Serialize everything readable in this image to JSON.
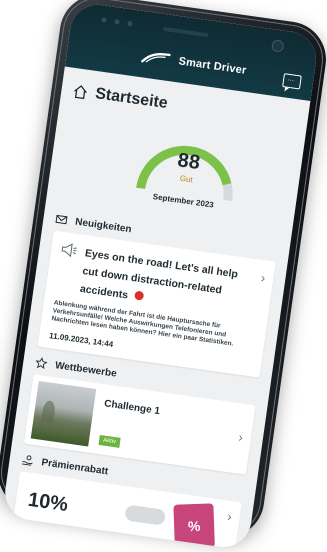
{
  "header": {
    "app_name": "Smart Driver",
    "chat_icon": "chat-icon"
  },
  "home": {
    "title": "Startseite",
    "icon": "home-icon"
  },
  "score": {
    "value": "88",
    "label": "Gut",
    "month": "September 2023",
    "fill_fraction": 0.88,
    "accent_color": "#7cc24a"
  },
  "news": {
    "section_title": "Neuigkeiten",
    "section_icon": "mail-icon",
    "item_icon": "megaphone-icon",
    "title": "Eyes on the road! Let's all help cut down distraction-related accidents",
    "body": "Ablenkung während der Fahrt ist die Hauptursache für Verkehrsunfälle! Welche Auswirkungen Telefonieren und Nachrichten lesen haben können? Hier ein paar Statistiken.",
    "date": "11.09.2023, 14:44"
  },
  "competitions": {
    "section_title": "Wettbewerbe",
    "section_icon": "star-icon",
    "challenge_title": "Challenge 1",
    "status": "Aktiv"
  },
  "premium": {
    "section_title": "Prämienrabatt",
    "section_icon": "hand-coin-icon",
    "percent": "10%",
    "tile_text": "%"
  },
  "chevron": "›"
}
